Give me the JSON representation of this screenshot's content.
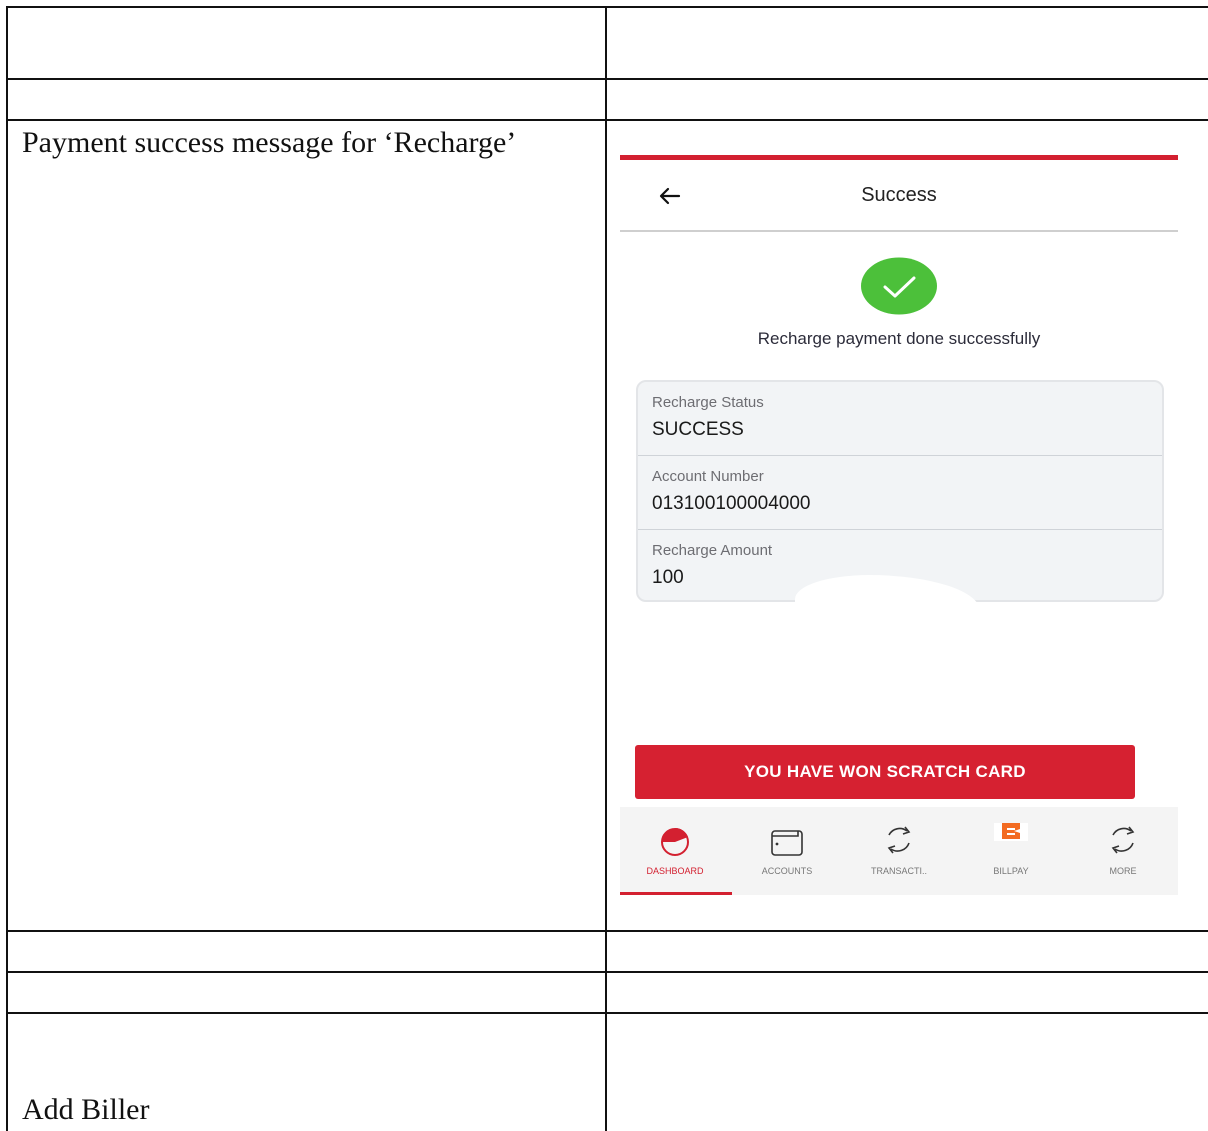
{
  "document": {
    "row_label_recharge": "Payment success message for ‘Recharge’",
    "row_label_add_biller": "Add Biller"
  },
  "screen": {
    "header_title": "Success",
    "success_message": "Recharge payment done successfully",
    "details": [
      {
        "label": "Recharge Status",
        "value": "SUCCESS"
      },
      {
        "label": "Account Number",
        "value": "013100100004000"
      },
      {
        "label": "Recharge Amount",
        "value": "100"
      }
    ],
    "scratch_button_label": "YOU HAVE WON SCRATCH CARD",
    "nav": {
      "items": [
        {
          "label": "DASHBOARD",
          "icon": "dashboard-icon",
          "active": true
        },
        {
          "label": "ACCOUNTS",
          "icon": "wallet-icon"
        },
        {
          "label": "TRANSACTI..",
          "icon": "transactions-icon"
        },
        {
          "label": "BILLPAY",
          "icon": "billpay-icon"
        },
        {
          "label": "MORE",
          "icon": "more-icon"
        }
      ]
    },
    "colors": {
      "brand_red": "#d32030",
      "success_green": "#4cc03a",
      "billpay_orange": "#f36b21"
    }
  }
}
